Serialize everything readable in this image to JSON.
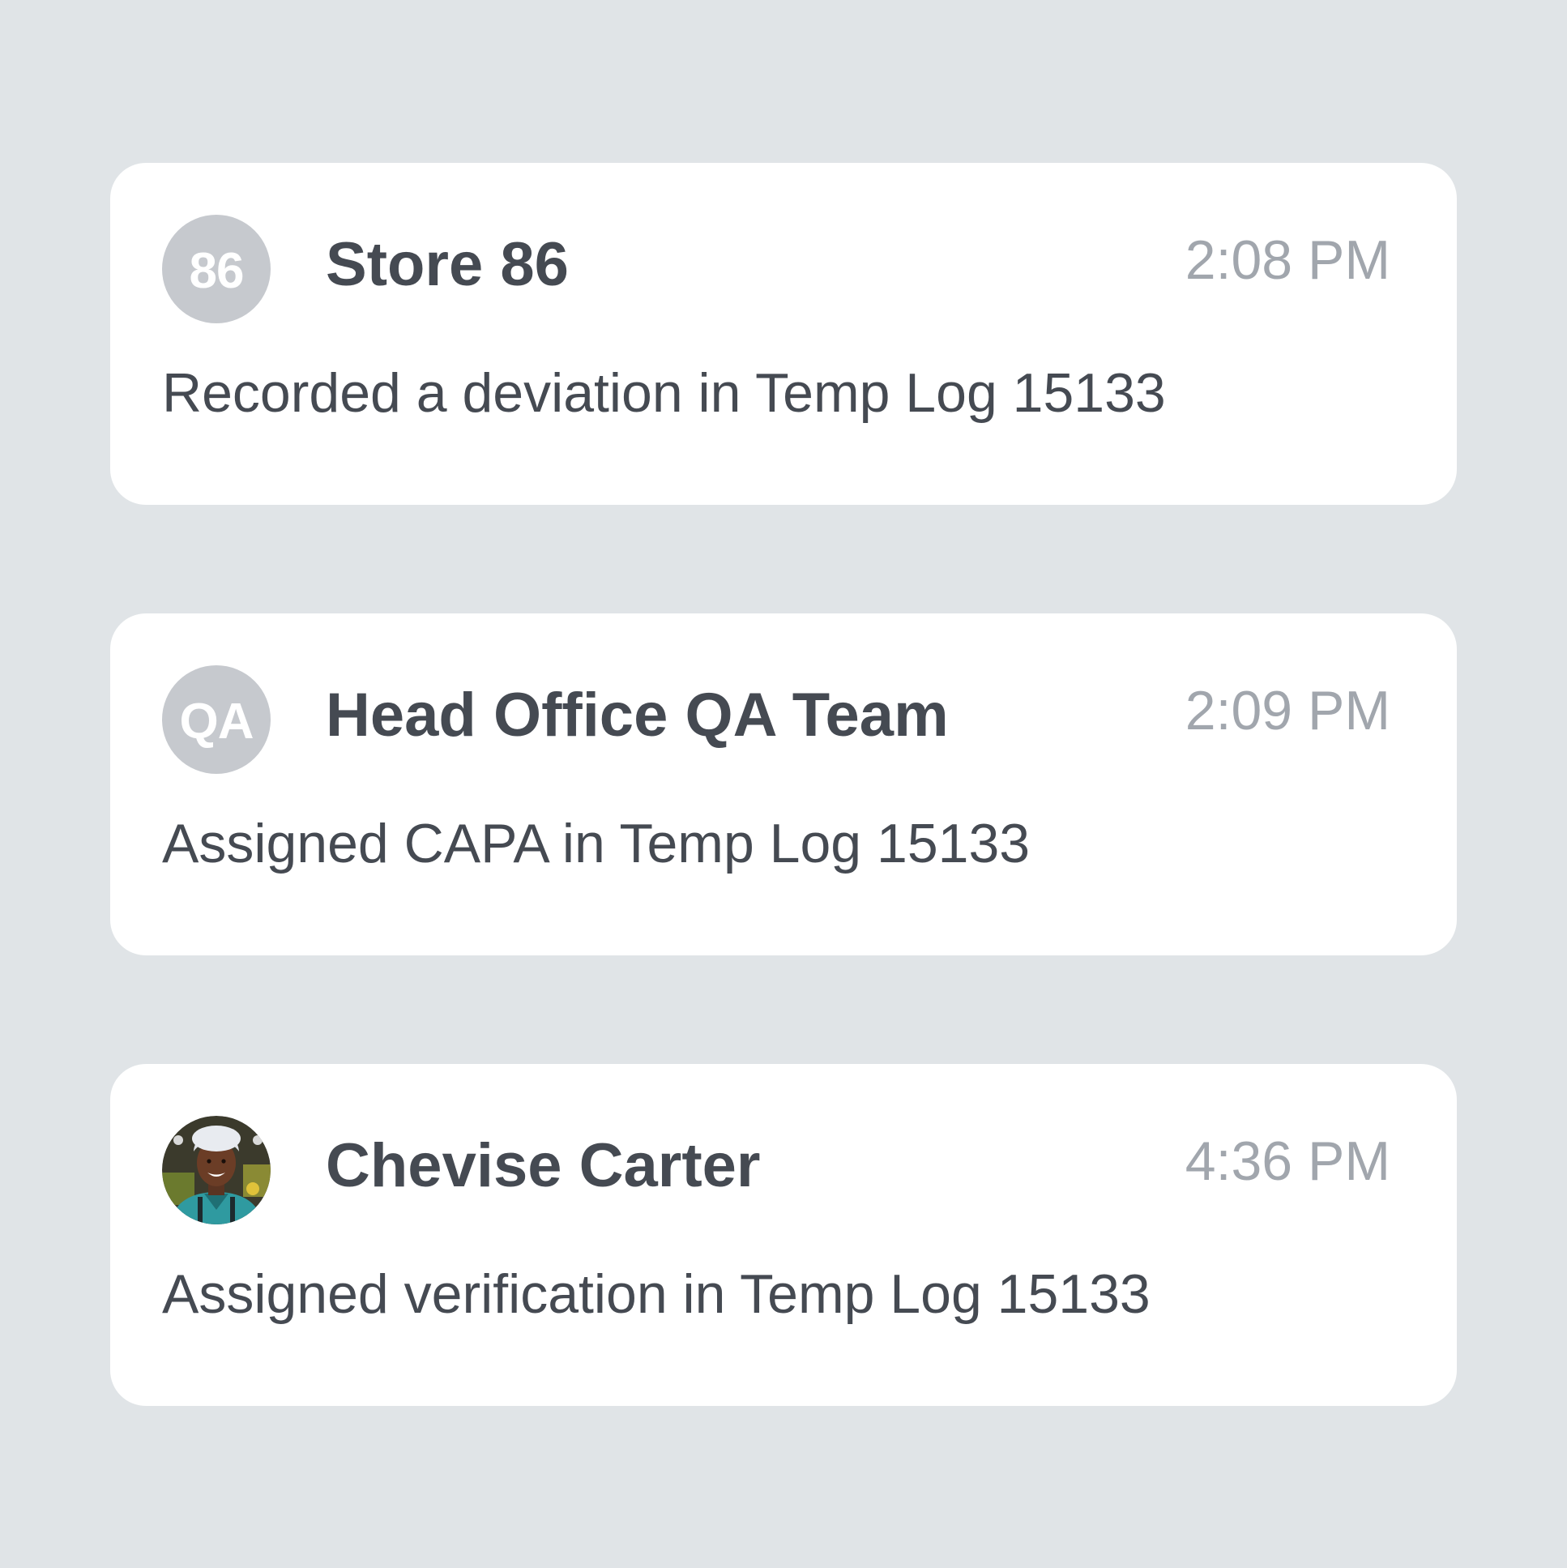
{
  "activity_feed": [
    {
      "avatar_initials": "86",
      "name": "Store 86",
      "time": "2:08 PM",
      "message": "Recorded a deviation in Temp Log 15133"
    },
    {
      "avatar_initials": "QA",
      "name": "Head Office QA Team",
      "time": "2:09 PM",
      "message": "Assigned CAPA in Temp Log 15133"
    },
    {
      "avatar_initials": "",
      "name": "Chevise Carter",
      "time": "4:36 PM",
      "message": "Assigned verification in Temp Log 15133"
    }
  ],
  "colors": {
    "background": "#e0e4e7",
    "card": "#ffffff",
    "avatar_bg": "#c6c9ce",
    "text_primary": "#454a52",
    "text_muted": "#a1a6ad"
  }
}
